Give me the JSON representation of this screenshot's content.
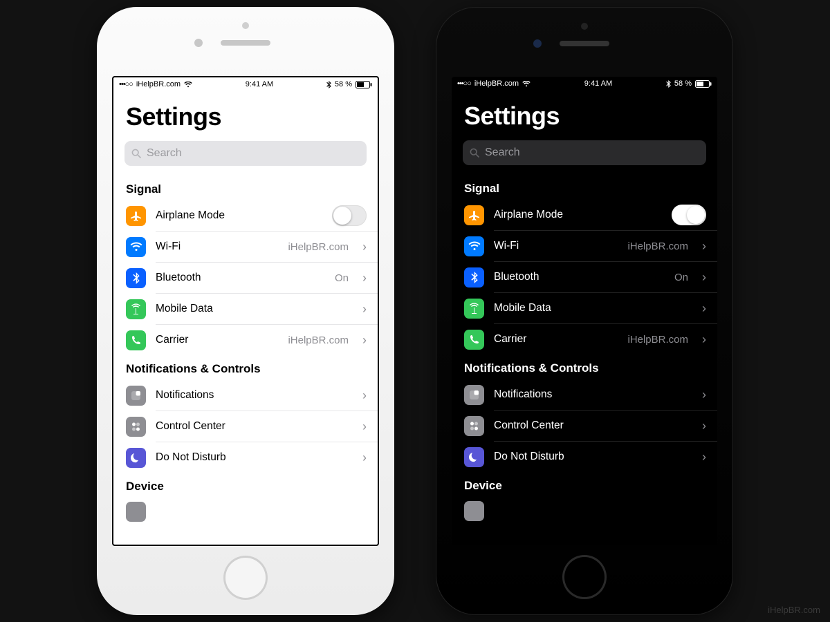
{
  "status": {
    "carrier": "iHelpBR.com",
    "time": "9:41 AM",
    "battery_pct": "58 %",
    "signal_dots": "•••○○"
  },
  "page_title": "Settings",
  "search": {
    "placeholder": "Search"
  },
  "sections": [
    {
      "header": "Signal",
      "rows": [
        {
          "name": "airplane-mode",
          "label": "Airplane Mode",
          "control": "toggle",
          "toggled": false,
          "icon": "airplane",
          "icon_bg": "#ff9500"
        },
        {
          "name": "wifi",
          "label": "Wi-Fi",
          "value": "iHelpBR.com",
          "icon": "wifi",
          "icon_bg": "#007aff"
        },
        {
          "name": "bluetooth",
          "label": "Bluetooth",
          "value": "On",
          "icon": "bluetooth",
          "icon_bg": "#0a60ff"
        },
        {
          "name": "mobile-data",
          "label": "Mobile Data",
          "value": "",
          "icon": "cellular",
          "icon_bg": "#34c759"
        },
        {
          "name": "carrier",
          "label": "Carrier",
          "value": "iHelpBR.com",
          "icon": "phone",
          "icon_bg": "#34c759"
        }
      ]
    },
    {
      "header": "Notifications & Controls",
      "rows": [
        {
          "name": "notifications",
          "label": "Notifications",
          "value": "",
          "icon": "notifications",
          "icon_bg": "#8e8e93"
        },
        {
          "name": "control-center",
          "label": "Control Center",
          "value": "",
          "icon": "control-center",
          "icon_bg": "#8e8e93"
        },
        {
          "name": "do-not-disturb",
          "label": "Do Not Disturb",
          "value": "",
          "icon": "moon",
          "icon_bg": "#5856d6"
        }
      ]
    },
    {
      "header": "Device",
      "rows": []
    }
  ],
  "watermark": "iHelpBR.com"
}
